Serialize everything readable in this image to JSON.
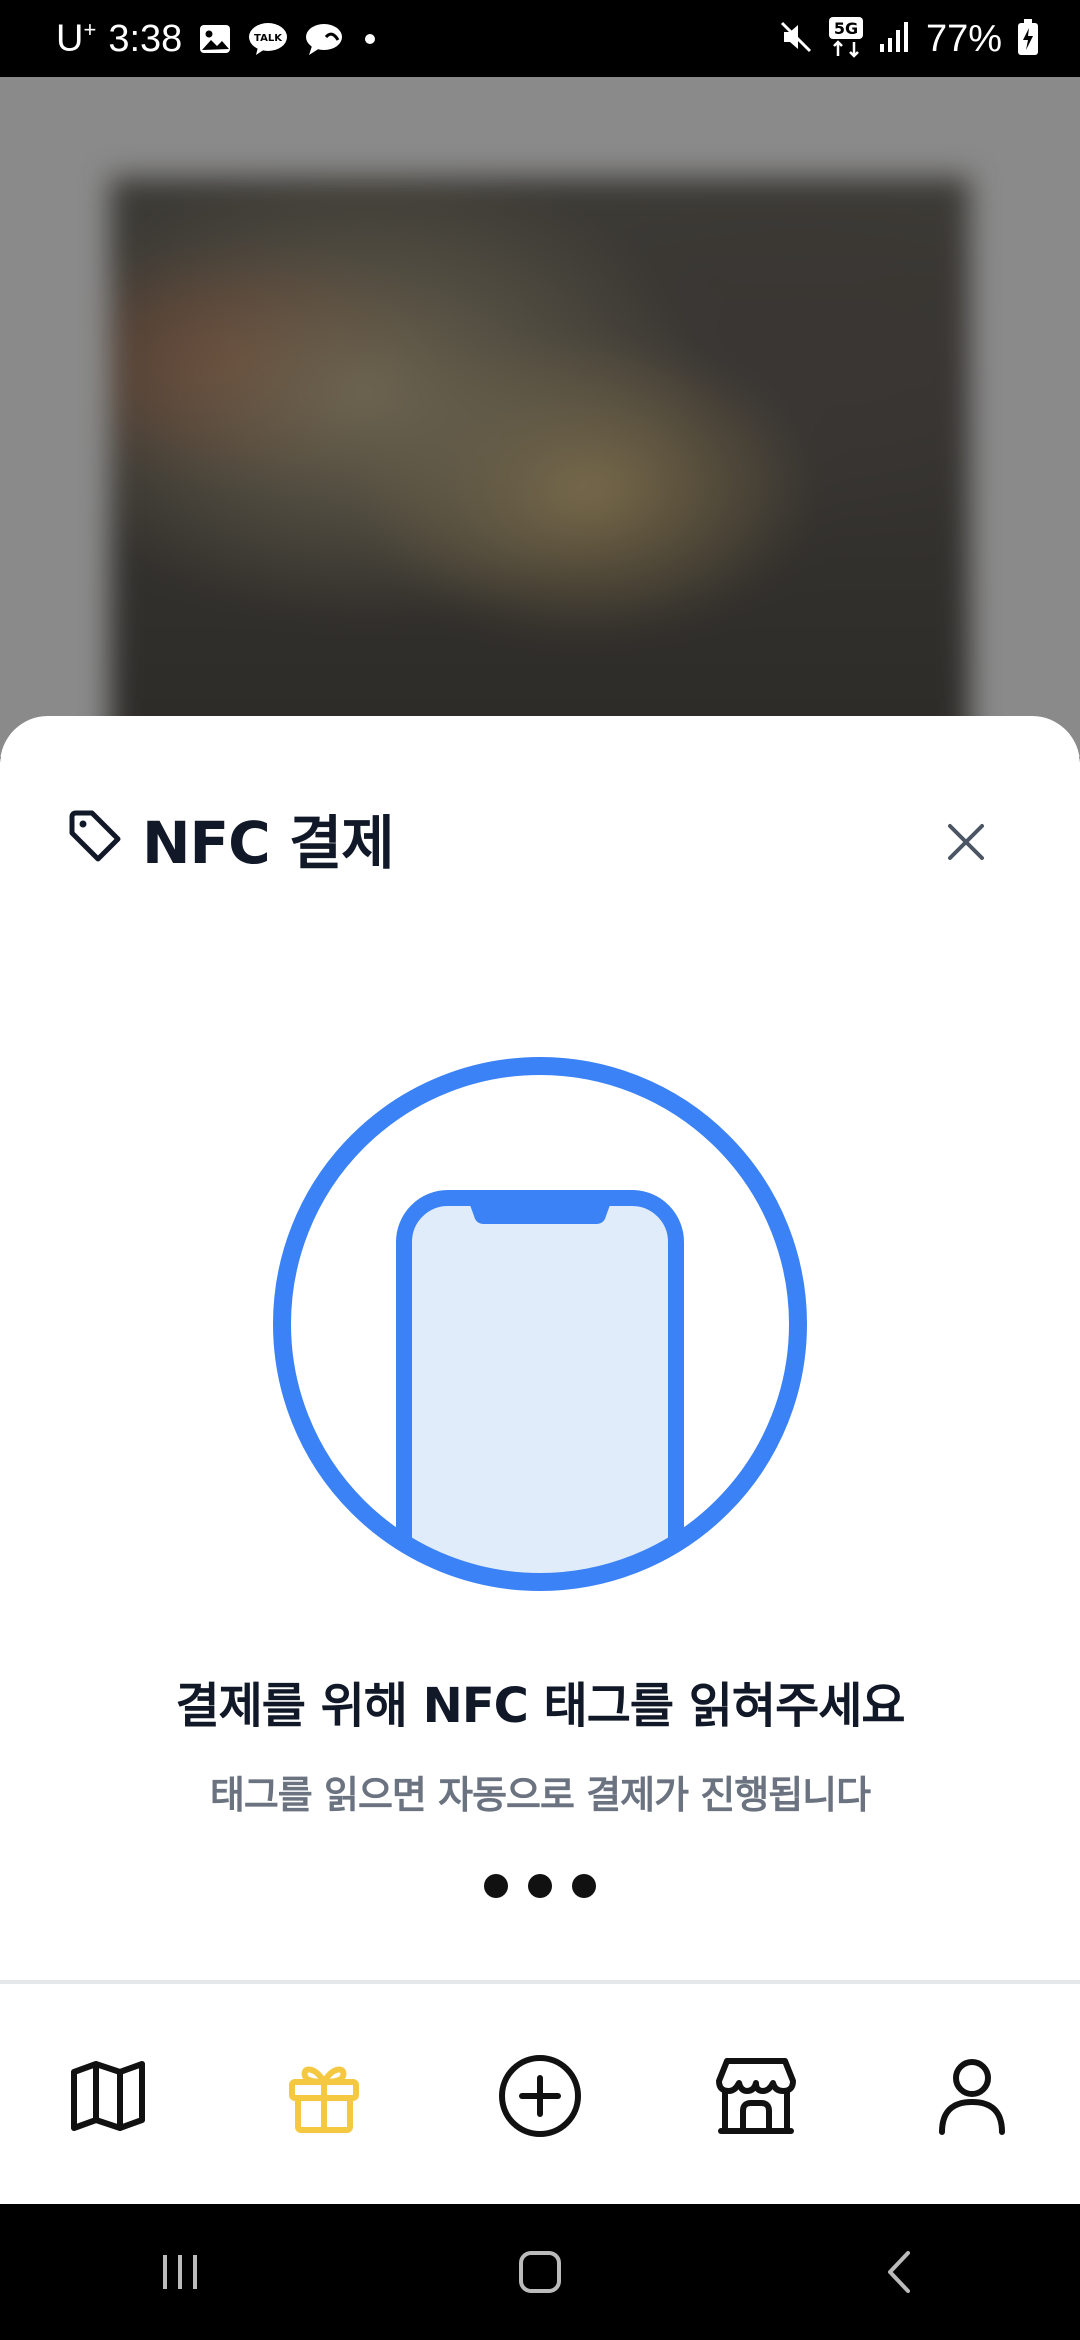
{
  "status_bar": {
    "carrier": "U",
    "carrier_sup": "+",
    "time": "3:38",
    "battery": "77%",
    "network": "5G"
  },
  "sheet": {
    "title": "NFC 결제",
    "main_message": "결제를 위해 NFC 태그를 읽혀주세요",
    "sub_message": "태그를 읽으면 자동으로 결제가 진행됩니다"
  },
  "nav": {
    "items": [
      {
        "icon": "map-icon",
        "active": false
      },
      {
        "icon": "gift-icon",
        "active": true
      },
      {
        "icon": "plus-circle-icon",
        "active": false
      },
      {
        "icon": "store-icon",
        "active": false
      },
      {
        "icon": "user-icon",
        "active": false
      }
    ]
  },
  "colors": {
    "accent": "#3B82F6",
    "phone_fill": "#E1ECFA",
    "active_nav": "#F5C842",
    "title": "#111827",
    "subtitle": "#6B7280"
  }
}
